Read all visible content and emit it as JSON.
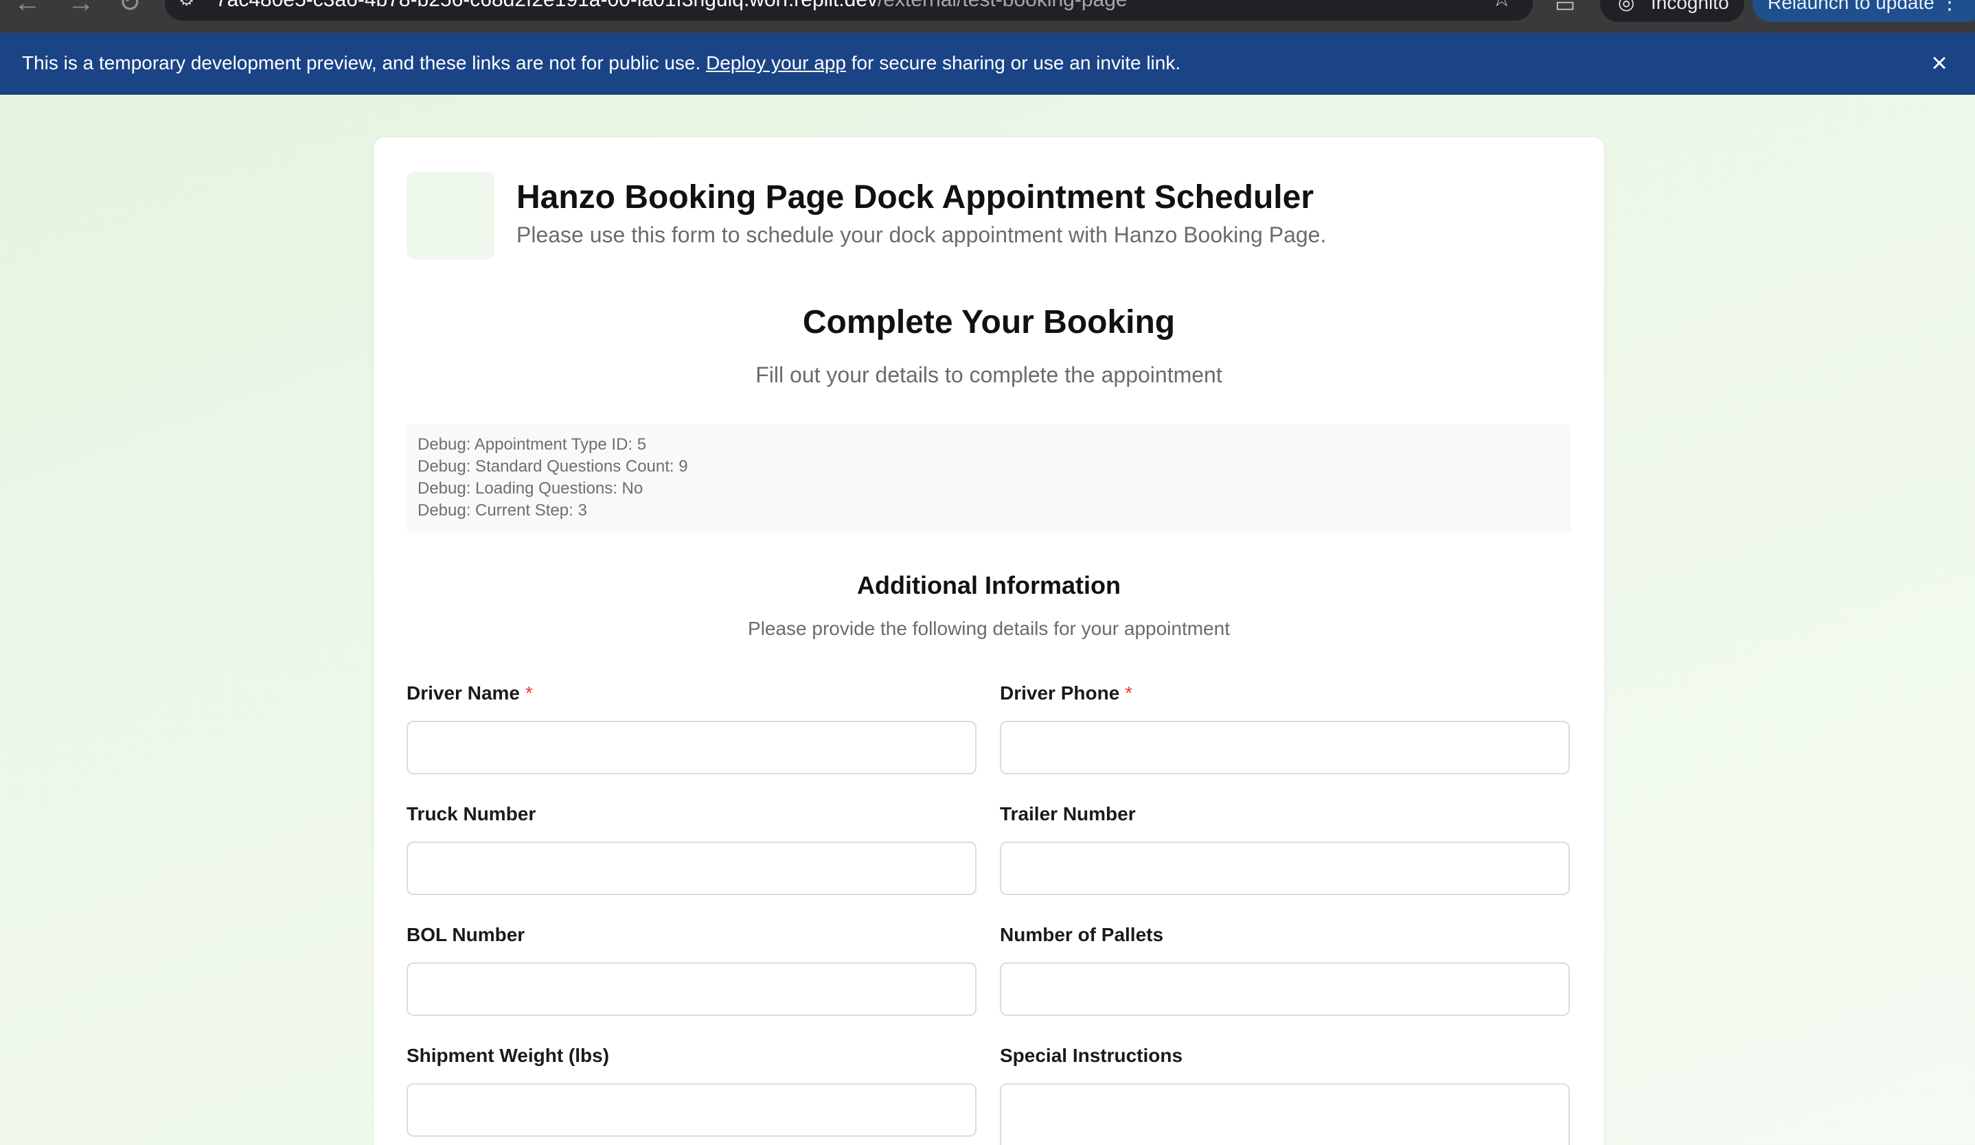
{
  "browser": {
    "url_host": "7ac480e5-c3a6-4b78-b256-c68d2f2e191a-00-la01f3ngulq.worf.replit.dev",
    "url_path": "/external/test-booking-page",
    "incognito_label": "Incognito",
    "relaunch_label": "Relaunch to update"
  },
  "banner": {
    "text_before": "This is a temporary development preview, and these links are not for public use. ",
    "link_text": "Deploy your app",
    "text_after": " for secure sharing or use an invite link."
  },
  "header": {
    "title": "Hanzo Booking Page Dock Appointment Scheduler",
    "subtitle": "Please use this form to schedule your dock appointment with Hanzo Booking Page."
  },
  "booking": {
    "title": "Complete Your Booking",
    "subtitle": "Fill out your details to complete the appointment"
  },
  "debug": [
    "Debug: Appointment Type ID: 5",
    "Debug: Standard Questions Count: 9",
    "Debug: Loading Questions: No",
    "Debug: Current Step: 3"
  ],
  "additional": {
    "title": "Additional Information",
    "subtitle": "Please provide the following details for your appointment"
  },
  "fields": [
    {
      "label": "Driver Name",
      "required": true,
      "value": ""
    },
    {
      "label": "Driver Phone",
      "required": true,
      "value": ""
    },
    {
      "label": "Truck Number",
      "required": false,
      "value": ""
    },
    {
      "label": "Trailer Number",
      "required": false,
      "value": ""
    },
    {
      "label": "BOL Number",
      "required": false,
      "value": ""
    },
    {
      "label": "Number of Pallets",
      "required": false,
      "value": ""
    },
    {
      "label": "Shipment Weight (lbs)",
      "required": false,
      "value": ""
    },
    {
      "label": "Special Instructions",
      "required": false,
      "value": ""
    }
  ],
  "required_marker": "*",
  "colors": {
    "banner": "#1b4486",
    "required": "#e53935",
    "page_bg": "#e3f4df"
  },
  "icons": [
    "back-arrow-icon",
    "forward-arrow-icon",
    "reload-icon",
    "site-info-icon",
    "bookmark-star-icon",
    "cast-icon",
    "incognito-icon",
    "more-vert-icon",
    "close-icon"
  ]
}
